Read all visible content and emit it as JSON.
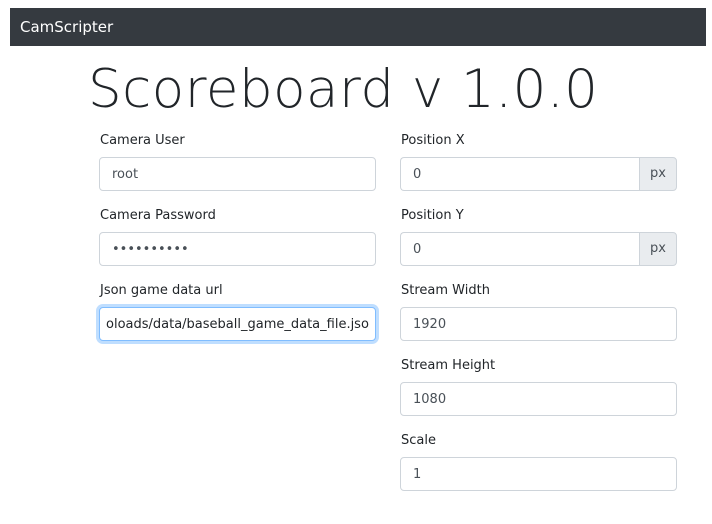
{
  "navbar": {
    "brand": "CamScripter"
  },
  "page": {
    "title": "Scoreboard v 1.0.0"
  },
  "form": {
    "camera_user": {
      "label": "Camera User",
      "value": "root"
    },
    "camera_password": {
      "label": "Camera Password",
      "value": "••••••••••"
    },
    "json_url": {
      "label": "Json game data url",
      "value": "oloads/data/baseball_game_data_file.json"
    },
    "position_x": {
      "label": "Position X",
      "value": "0",
      "unit": "px"
    },
    "position_y": {
      "label": "Position Y",
      "value": "0",
      "unit": "px"
    },
    "stream_width": {
      "label": "Stream Width",
      "value": "1920"
    },
    "stream_height": {
      "label": "Stream Height",
      "value": "1080"
    },
    "scale": {
      "label": "Scale",
      "value": "1"
    }
  },
  "colors": {
    "navbar_bg": "#353a40",
    "focus_border": "#80bdff",
    "addon_bg": "#e9ecef"
  }
}
